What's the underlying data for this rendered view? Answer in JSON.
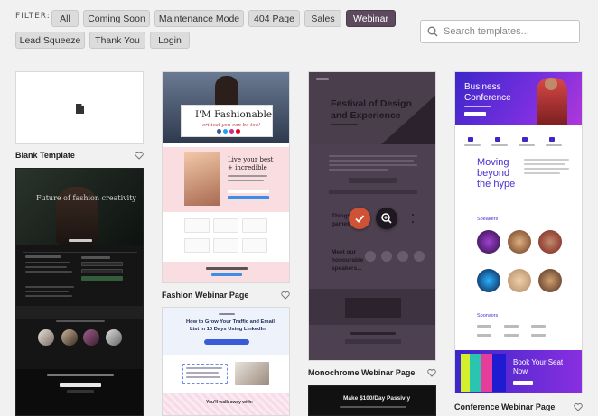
{
  "filter": {
    "label": "FILTER:",
    "chips": [
      "All",
      "Coming Soon",
      "Maintenance Mode",
      "404 Page",
      "Sales",
      "Webinar",
      "Lead Squeeze",
      "Thank You",
      "Login"
    ],
    "active": "Webinar"
  },
  "search": {
    "placeholder": "Search templates..."
  },
  "templates": {
    "blank": {
      "name": "Blank Template"
    },
    "fashion": {
      "name": "Fashion Webinar Page",
      "hero_title": "I'M Fashionable",
      "hero_sub": "critical you can be too!",
      "promo_title": "Live your best",
      "promo_title2": "+ incredible"
    },
    "monochrome": {
      "name": "Monochrome Webinar Page",
      "hero_title": "Festival of Design",
      "hero_title2": "and Experience",
      "sub_heading": "Meet our",
      "sub_heading2": "honourable",
      "sub_heading3": "speakers...",
      "mid_text": "Things",
      "mid_text2": "games"
    },
    "conference": {
      "name": "Conference Webinar Page",
      "hero_title": "Business",
      "hero_title2": "Conference",
      "big_text": "Moving",
      "big_text2": "beyond",
      "big_text3": "the hype",
      "speakers_label": "Speakers",
      "sponsors_label": "Sponsors",
      "cta": "Book Your Seat",
      "cta2": "Now"
    },
    "creativity": {
      "hero_title": "Future of fashion creativity"
    },
    "linkedin": {
      "title": "How to Grow Your Traffic and Email",
      "title2": "List in 10 Days Using LinkedIn",
      "bottom": "You'll walk away with:"
    },
    "passivity": {
      "title": "Make $100/Day Passivly"
    }
  }
}
